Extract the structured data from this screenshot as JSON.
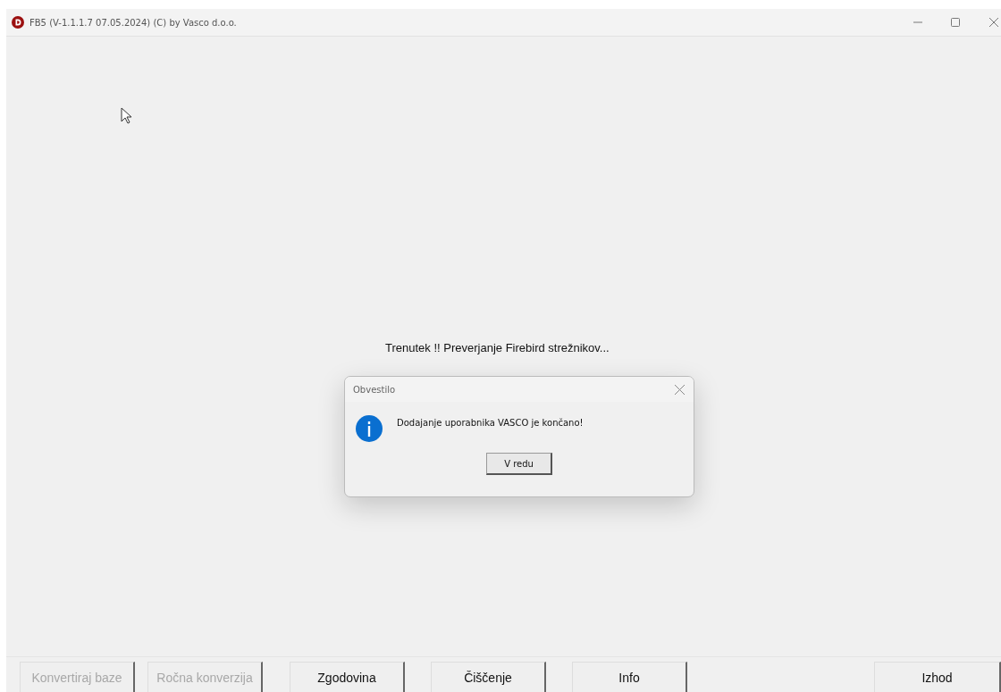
{
  "window": {
    "title": "FB5 (V-1.1.1.7  07.05.2024) (C) by Vasco d.o.o."
  },
  "status_message": "Trenutek !!  Preverjanje Firebird strežnikov...",
  "dialog": {
    "title": "Obvestilo",
    "message": "Dodajanje uporabnika VASCO je končano!",
    "button": "V redu"
  },
  "buttons": [
    {
      "label": "Konvertiraj baze",
      "disabled": true
    },
    {
      "label": "Ročna konverzija",
      "disabled": true
    },
    {
      "label": "Zgodovina",
      "disabled": false
    },
    {
      "label": "Čiščenje",
      "disabled": false
    },
    {
      "label": "Info",
      "disabled": false
    },
    {
      "label": "Izhod",
      "disabled": false
    }
  ]
}
